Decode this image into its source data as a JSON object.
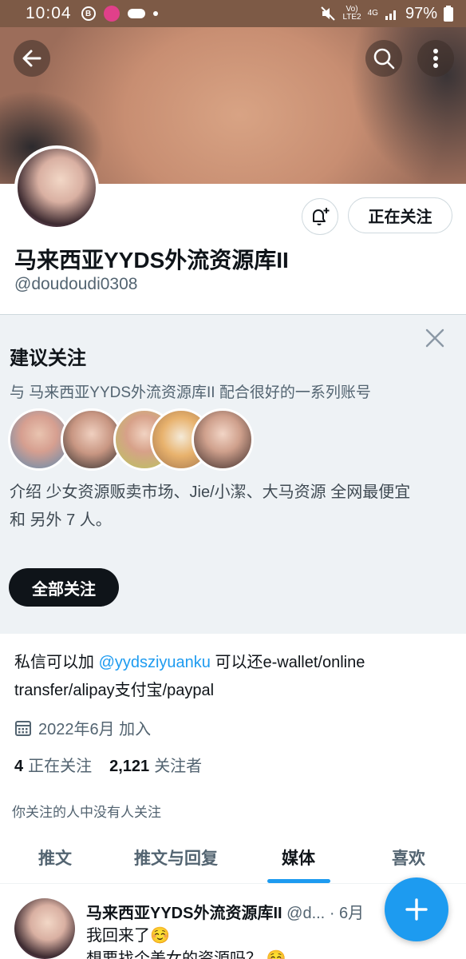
{
  "status_bar": {
    "time": "10:04",
    "badge_letter": "B",
    "network_top": "Vo)",
    "network_bottom": "LTE2",
    "data_type": "4G",
    "battery": "97%"
  },
  "profile": {
    "display_name": "马来西亚YYDS外流资源库II",
    "handle": "@doudoudi0308",
    "following_button": "正在关注"
  },
  "suggestions": {
    "title": "建议关注",
    "subtitle": "与 马来西亚YYDS外流资源库II 配合很好的一系列账号",
    "description": "介绍 少女资源贩卖市场、Jie/小潔、大马资源 全网最便宜 和 另外 7 人。",
    "follow_all": "全部关注"
  },
  "bio": {
    "text_before": "私信可以加 ",
    "mention": "@yydsziyuanku",
    "text_after": " 可以还e-wallet/online transfer/alipay支付宝/paypal",
    "joined": "2022年6月 加入"
  },
  "stats": {
    "following_count": "4",
    "following_label": "正在关注",
    "followers_count": "2,121",
    "followers_label": "关注者"
  },
  "no_followers_note": "你关注的人中没有人关注",
  "tabs": {
    "tweets": "推文",
    "replies": "推文与回复",
    "media": "媒体",
    "likes": "喜欢"
  },
  "tweet": {
    "name": "马来西亚YYDS外流资源库II",
    "handle": "@d...",
    "time": "· 6月",
    "line1": "我回来了☺️",
    "line2": "想要找个美女的资源吗？ ☺️"
  },
  "colors": {
    "accent": "#1d9bf0",
    "suggest_bg": "#eef2f5",
    "primary_text": "#0f1419",
    "secondary_text": "#536471"
  }
}
